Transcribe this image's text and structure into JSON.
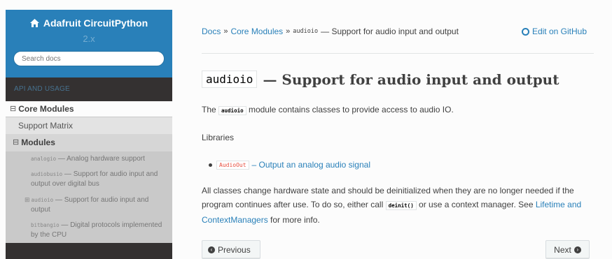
{
  "sidebar": {
    "brand": "Adafruit CircuitPython",
    "version": "2.x",
    "search_placeholder": "Search docs",
    "caption": "API AND USAGE",
    "core_modules": {
      "toggle": "⊟",
      "label": "Core Modules"
    },
    "support_matrix": "Support Matrix",
    "modules": {
      "toggle": "⊟",
      "label": "Modules"
    },
    "module_items": [
      {
        "code": "analogio",
        "desc": " — Analog hardware support"
      },
      {
        "code": "audiobusio",
        "desc": " — Support for audio input and output over digital bus"
      },
      {
        "prefix": "⊞",
        "code": "audioio",
        "desc": " — Support for audio input and output"
      },
      {
        "code": "bitbangio",
        "desc": " — Digital protocols implemented by the CPU"
      }
    ]
  },
  "breadcrumbs": {
    "docs": "Docs",
    "sep": "»",
    "core_modules": "Core Modules",
    "current_code": "audioio",
    "current_text": "— Support for audio input and output",
    "edit": "Edit on GitHub"
  },
  "main": {
    "title_code": "audioio",
    "title_text": "— Support for audio input and output",
    "p1_pre": "The ",
    "p1_code": "audioio",
    "p1_post": " module contains classes to provide access to audio IO.",
    "libraries": "Libraries",
    "item_code": "AudioOut",
    "item_text": "– Output an analog audio signal",
    "p3_pre": "All classes change hardware state and should be deinitialized when they are no longer needed if the program continues after use. To do so, either call ",
    "p3_code": "deinit()",
    "p3_mid": " or use a context manager. See ",
    "p3_link": "Lifetime and ContextManagers",
    "p3_post": " for more info.",
    "prev_label": "Previous",
    "next_label": "Next"
  },
  "colors": {
    "accent": "#2980b9",
    "sidebar_bg": "#343131",
    "link": "#2980b9",
    "code_red": "#e74c3c"
  }
}
